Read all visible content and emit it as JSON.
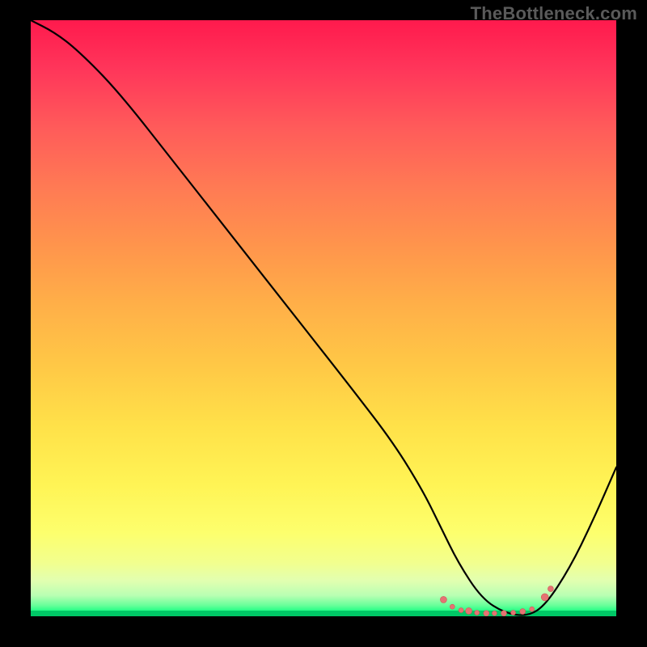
{
  "watermark": {
    "text": "TheBottleneck.com"
  },
  "colors": {
    "curve": "#000000",
    "markers_fill": "#e57373",
    "markers_stroke": "#d05a5a",
    "background": "#000000"
  },
  "chart_data": {
    "type": "line",
    "title": "",
    "xlabel": "",
    "ylabel": "",
    "xlim": [
      0,
      100
    ],
    "ylim": [
      0,
      100
    ],
    "grid": false,
    "legend": false,
    "background_gradient": "vertical red→orange→yellow→green",
    "series": [
      {
        "name": "curve",
        "x": [
          0,
          4,
          8,
          15,
          25,
          35,
          45,
          55,
          62,
          67,
          70,
          73,
          77,
          81,
          85,
          88,
          92,
          96,
          100
        ],
        "y": [
          100,
          98,
          95,
          88,
          75.5,
          63,
          50.5,
          38,
          29,
          21,
          15,
          9,
          3,
          0.5,
          0,
          2,
          8,
          16,
          25
        ],
        "stroke": "#000000",
        "stroke_width": 2
      }
    ],
    "markers": {
      "name": "salmon-dots",
      "description": "cluster of salmon/pink dots near the trough of the curve",
      "fill": "#e57373",
      "points": [
        {
          "x": 70.5,
          "y": 2.8,
          "r": 4
        },
        {
          "x": 72.0,
          "y": 1.6,
          "r": 3
        },
        {
          "x": 73.5,
          "y": 1.0,
          "r": 3
        },
        {
          "x": 74.8,
          "y": 0.9,
          "r": 4
        },
        {
          "x": 76.2,
          "y": 0.6,
          "r": 3
        },
        {
          "x": 77.8,
          "y": 0.5,
          "r": 3.5
        },
        {
          "x": 79.2,
          "y": 0.5,
          "r": 3
        },
        {
          "x": 80.8,
          "y": 0.5,
          "r": 3.5
        },
        {
          "x": 82.4,
          "y": 0.6,
          "r": 3
        },
        {
          "x": 84.0,
          "y": 0.8,
          "r": 3.5
        },
        {
          "x": 85.6,
          "y": 1.2,
          "r": 3
        },
        {
          "x": 87.8,
          "y": 3.2,
          "r": 4.5
        },
        {
          "x": 88.8,
          "y": 4.6,
          "r": 3.5
        }
      ]
    }
  }
}
